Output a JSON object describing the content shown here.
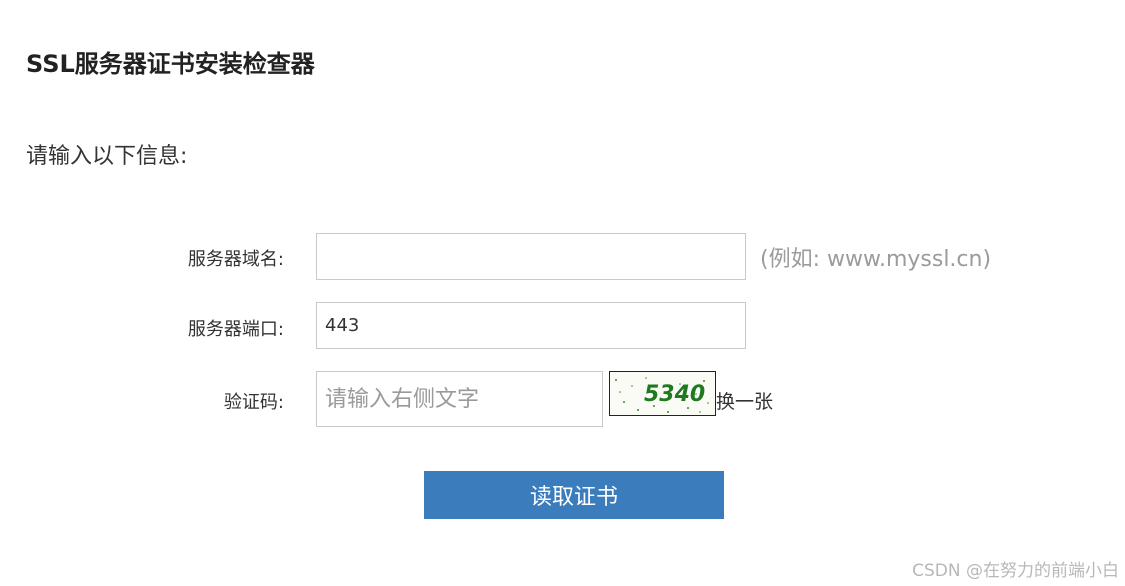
{
  "header": {
    "title": "SSL服务器证书安装检查器"
  },
  "form": {
    "instruction": "请输入以下信息:",
    "domain": {
      "label": "服务器域名:",
      "value": "",
      "hint": "(例如: www.myssl.cn)"
    },
    "port": {
      "label": "服务器端口:",
      "value": "443"
    },
    "captcha": {
      "label": "验证码:",
      "placeholder": "请输入右侧文字",
      "image_text": "5340",
      "refresh_label": "换一张"
    },
    "submit_label": "读取证书"
  },
  "watermark": "CSDN @在努力的前端小白",
  "colors": {
    "button_bg": "#3a7cbc",
    "input_border": "#c9c9c9",
    "hint": "#9b9b9b",
    "captcha_text": "#1f7a1f"
  }
}
